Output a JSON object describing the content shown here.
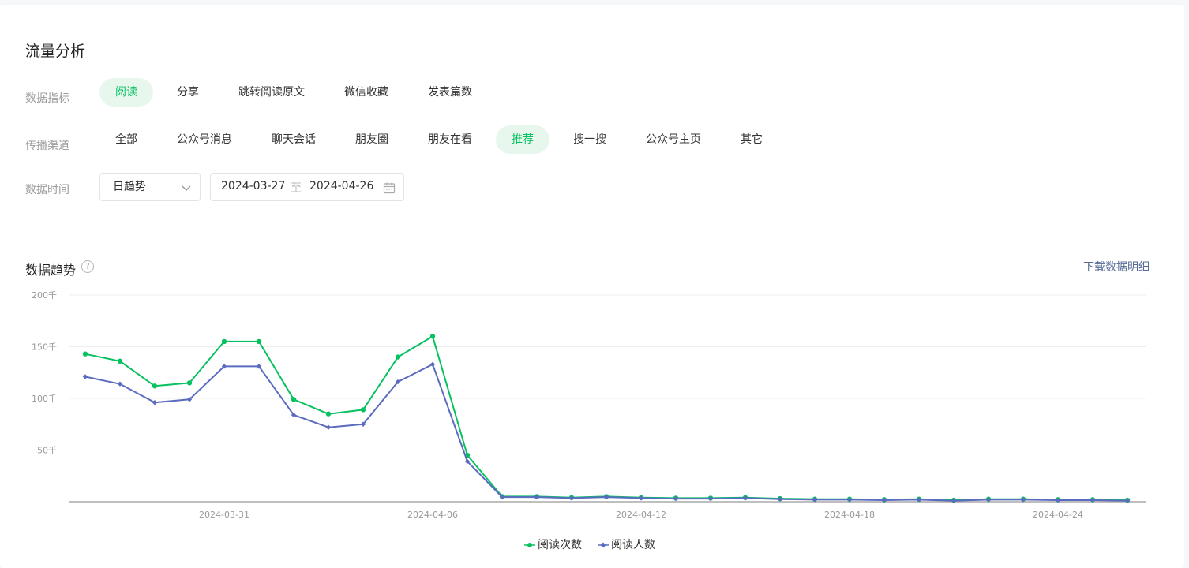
{
  "page_title": "流量分析",
  "metrics": {
    "label": "数据指标",
    "options": [
      "阅读",
      "分享",
      "跳转阅读原文",
      "微信收藏",
      "发表篇数"
    ],
    "active_index": 0
  },
  "channels": {
    "label": "传播渠道",
    "options": [
      "全部",
      "公众号消息",
      "聊天会话",
      "朋友圈",
      "朋友在看",
      "推荐",
      "搜一搜",
      "公众号主页",
      "其它"
    ],
    "active_index": 5
  },
  "time": {
    "label": "数据时间",
    "granularity": "日趋势",
    "start_date": "2024-03-27",
    "separator": "至",
    "end_date": "2024-04-26"
  },
  "trend": {
    "title": "数据趋势",
    "help_glyph": "?",
    "download_label": "下载数据明细"
  },
  "colors": {
    "accent": "#07c160",
    "series_reads": "#07c160",
    "series_readers": "#5b6bbf",
    "link": "#576b95"
  },
  "chart_data": {
    "type": "line",
    "x": [
      "2024-03-27",
      "2024-03-28",
      "2024-03-29",
      "2024-03-30",
      "2024-03-31",
      "2024-04-01",
      "2024-04-02",
      "2024-04-03",
      "2024-04-04",
      "2024-04-05",
      "2024-04-06",
      "2024-04-07",
      "2024-04-08",
      "2024-04-09",
      "2024-04-10",
      "2024-04-11",
      "2024-04-12",
      "2024-04-13",
      "2024-04-14",
      "2024-04-15",
      "2024-04-16",
      "2024-04-17",
      "2024-04-18",
      "2024-04-19",
      "2024-04-20",
      "2024-04-21",
      "2024-04-22",
      "2024-04-23",
      "2024-04-24",
      "2024-04-25",
      "2024-04-26"
    ],
    "x_tick_labels": [
      "2024-03-31",
      "2024-04-06",
      "2024-04-12",
      "2024-04-18",
      "2024-04-24"
    ],
    "y_tick_labels": [
      "50千",
      "100千",
      "150千",
      "200千"
    ],
    "y_ticks": [
      50,
      100,
      150,
      200
    ],
    "ylim": [
      0,
      200
    ],
    "y_unit_note": "values in 千",
    "grid": true,
    "legend_position": "bottom-center",
    "series": [
      {
        "name": "阅读次数",
        "color": "#07c160",
        "marker": "circle",
        "values": [
          143,
          136,
          112,
          115,
          155,
          155,
          99,
          85,
          89,
          140,
          160,
          45,
          5,
          5,
          4,
          5,
          4,
          3.5,
          3.5,
          4,
          3,
          2.5,
          2.5,
          2,
          2.5,
          1.5,
          2.5,
          2.5,
          2,
          2,
          1.5
        ]
      },
      {
        "name": "阅读人数",
        "color": "#5b6bbf",
        "marker": "diamond",
        "values": [
          121,
          114,
          96,
          99,
          131,
          131,
          84,
          72,
          75,
          116,
          133,
          39,
          4.5,
          4.5,
          3.5,
          4.5,
          3.5,
          3,
          3,
          3.5,
          2.5,
          2,
          2,
          1.5,
          2,
          1,
          2,
          2,
          1.5,
          1.5,
          1
        ]
      }
    ]
  }
}
